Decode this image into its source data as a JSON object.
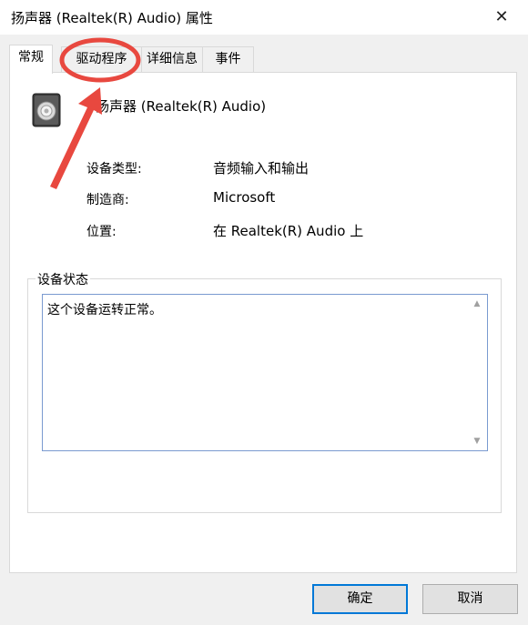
{
  "window": {
    "title": "扬声器 (Realtek(R) Audio) 属性",
    "close_glyph": "✕"
  },
  "tabs": [
    {
      "label": "常规",
      "active": true
    },
    {
      "label": "驱动程序",
      "active": false
    },
    {
      "label": "详细信息",
      "active": false
    },
    {
      "label": "事件",
      "active": false
    }
  ],
  "device": {
    "name": "扬声器 (Realtek(R) Audio)",
    "icon": "speaker-icon"
  },
  "properties": [
    {
      "label": "设备类型:",
      "value": "音频输入和输出"
    },
    {
      "label": "制造商:",
      "value": "Microsoft"
    },
    {
      "label": "位置:",
      "value": "在 Realtek(R) Audio 上"
    }
  ],
  "status_group": {
    "label": "设备状态",
    "text": "这个设备运转正常。"
  },
  "buttons": {
    "ok": "确定",
    "cancel": "取消"
  },
  "colors": {
    "annotation": "#e8483f",
    "focus_border": "#0078d7"
  }
}
